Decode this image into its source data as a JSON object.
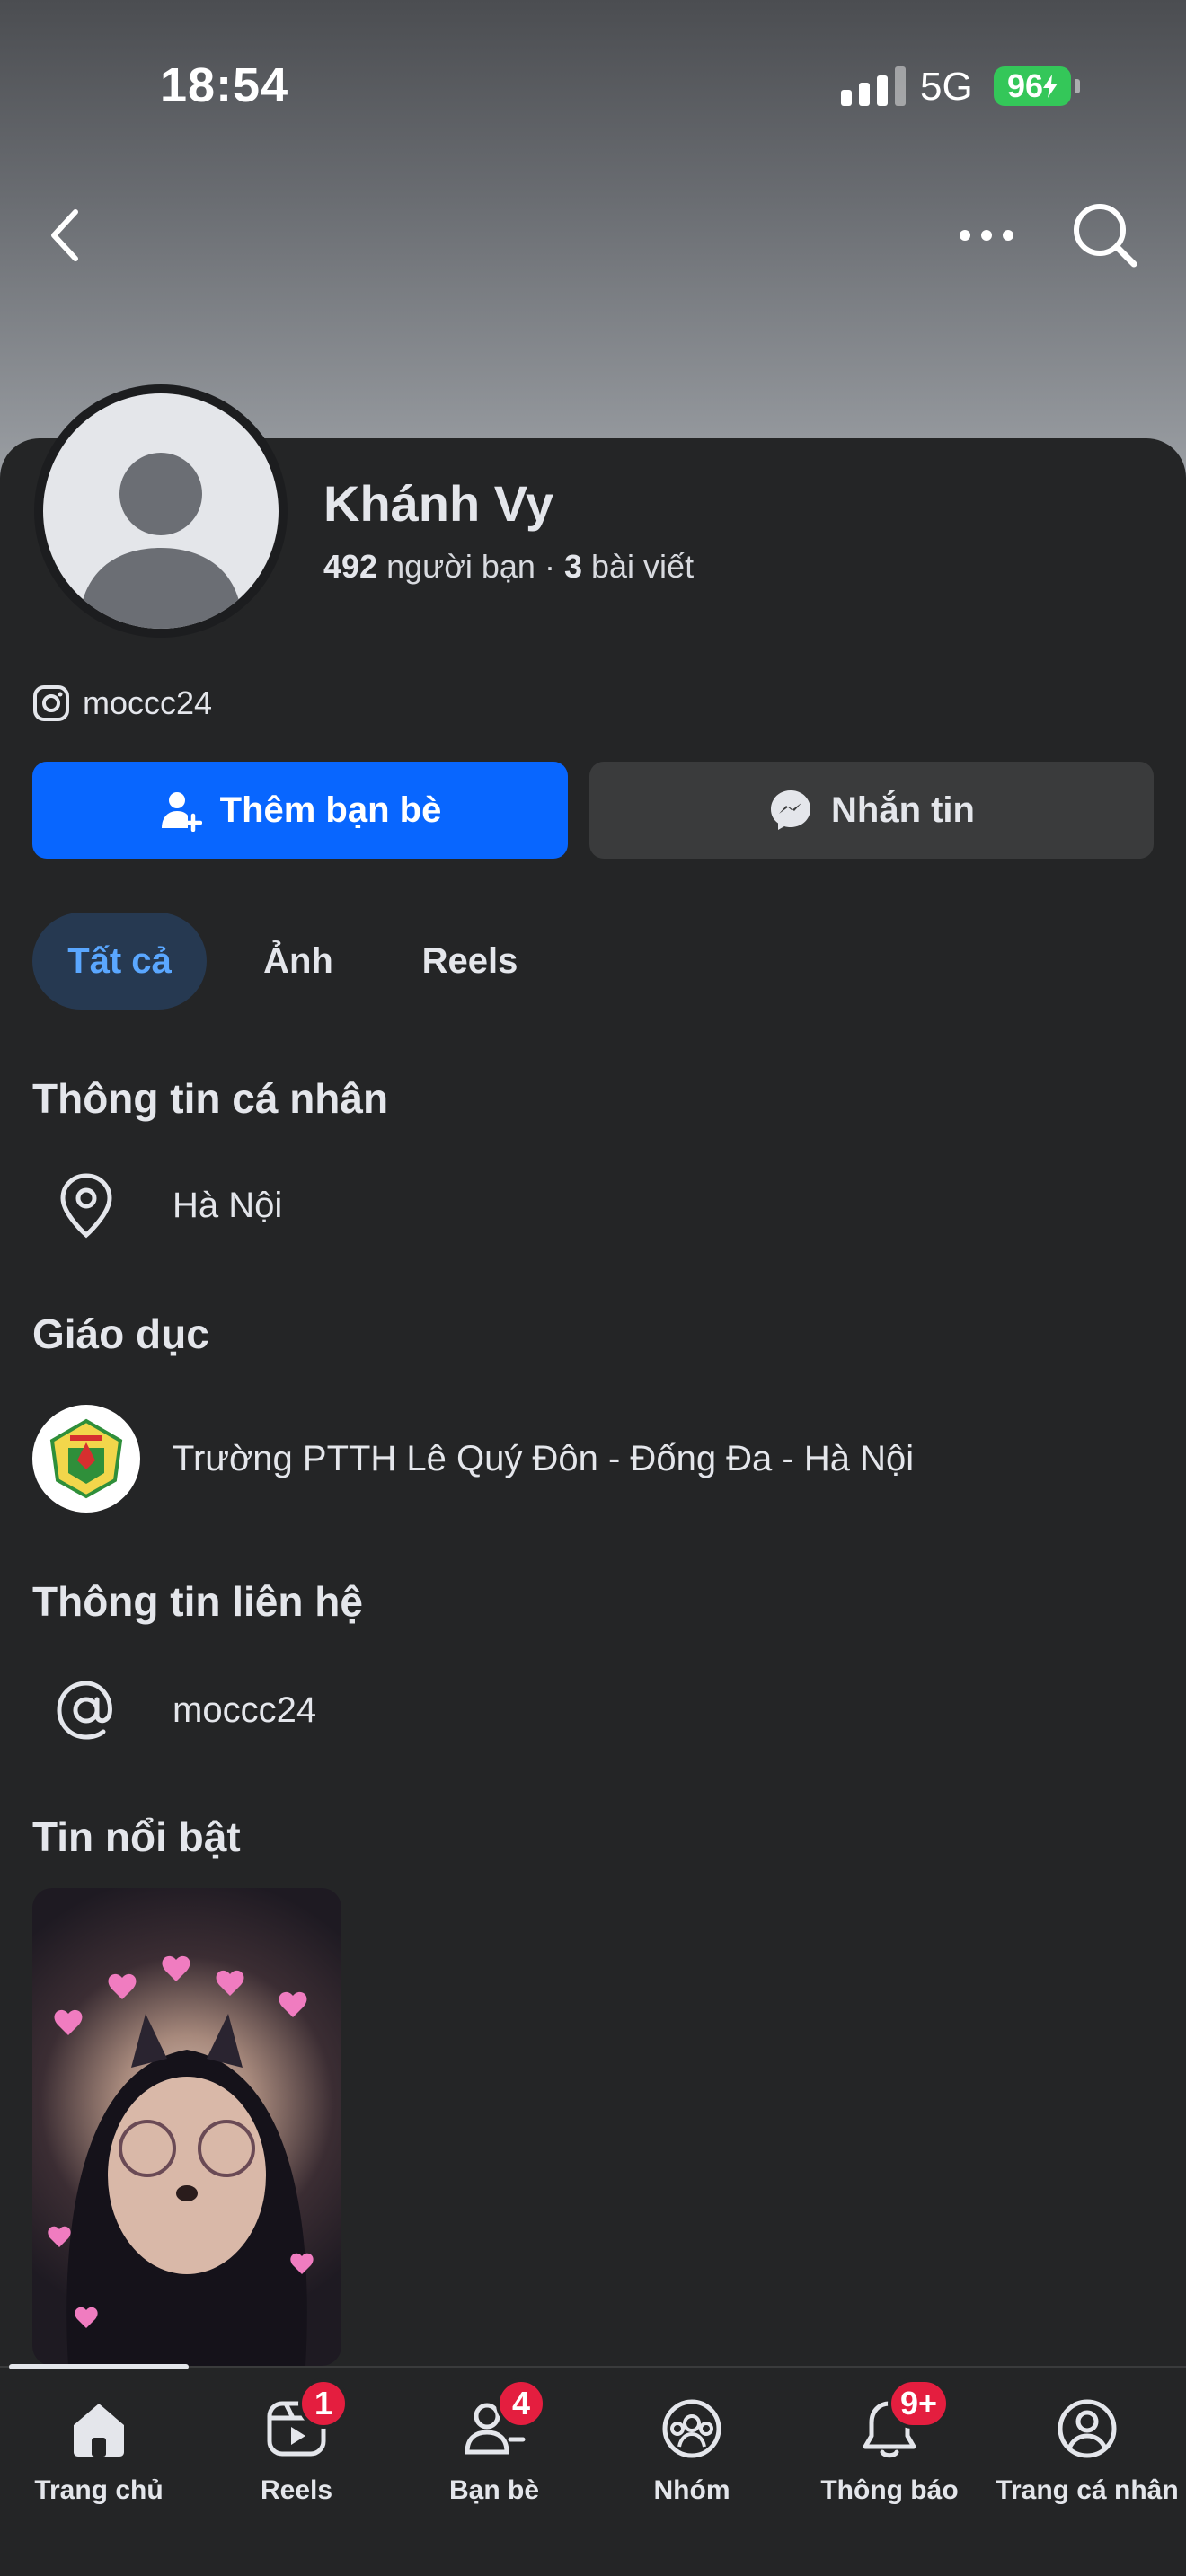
{
  "status_bar": {
    "time": "18:54",
    "network": "5G",
    "battery": "96"
  },
  "colors": {
    "accent": "#0866ff",
    "badge": "#e41e3f",
    "battery": "#34c759",
    "tab_active_text": "#5aa7ff"
  },
  "profile": {
    "name": "Khánh Vy",
    "friends_count": "492",
    "friends_label": "người bạn",
    "separator": "·",
    "posts_count": "3",
    "posts_label": "bài viết",
    "instagram": "moccc24"
  },
  "actions": {
    "add_friend": "Thêm bạn bè",
    "message": "Nhắn tin"
  },
  "tabs": [
    {
      "label": "Tất cả"
    },
    {
      "label": "Ảnh"
    },
    {
      "label": "Reels"
    }
  ],
  "sections": {
    "personal_info": {
      "title": "Thông tin cá nhân",
      "location": "Hà Nội"
    },
    "education": {
      "title": "Giáo dục",
      "school": "Trường PTTH Lê Quý Đôn - Đống Đa - Hà Nội"
    },
    "contact": {
      "title": "Thông tin liên hệ",
      "username": "moccc24"
    },
    "highlights": {
      "title": "Tin nổi bật"
    }
  },
  "bottom_nav": [
    {
      "label": "Trang chủ",
      "icon": "home-icon",
      "badge": ""
    },
    {
      "label": "Reels",
      "icon": "reels-icon",
      "badge": "1"
    },
    {
      "label": "Bạn bè",
      "icon": "friends-icon",
      "badge": "4"
    },
    {
      "label": "Nhóm",
      "icon": "groups-icon",
      "badge": ""
    },
    {
      "label": "Thông báo",
      "icon": "bell-icon",
      "badge": "9+"
    },
    {
      "label": "Trang cá nhân",
      "icon": "profile-icon",
      "badge": ""
    }
  ]
}
